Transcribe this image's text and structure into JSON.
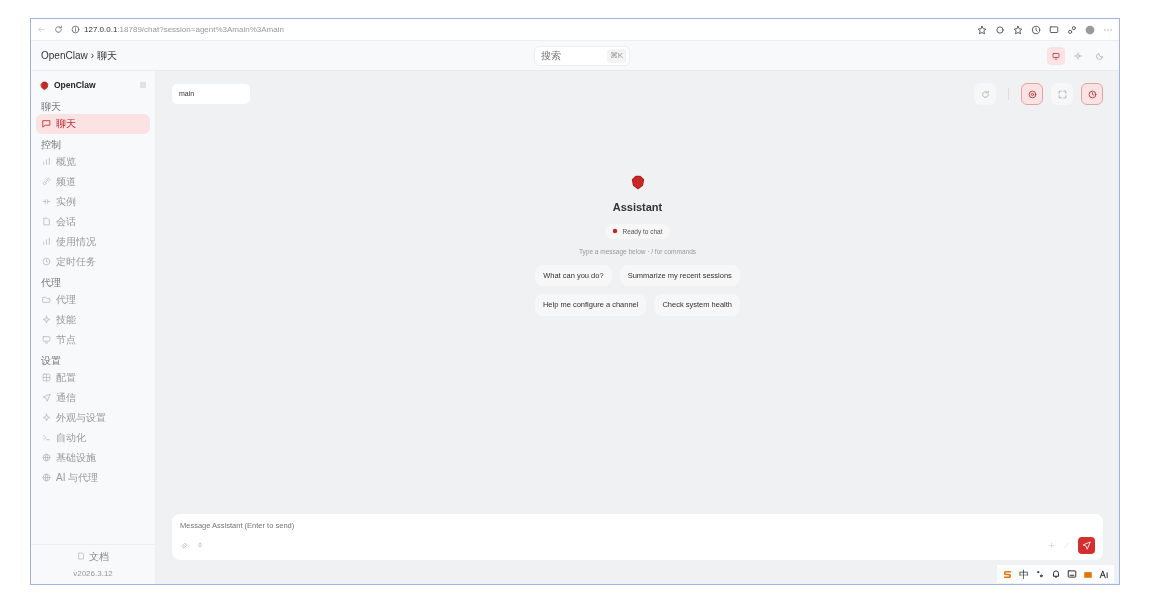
{
  "browser": {
    "url_host": "127.0.0.1",
    "url_rest": ":18789/chat?session=agent%3Amain%3Amain"
  },
  "header": {
    "breadcrumb": [
      "OpenClaw",
      "›",
      "聊天"
    ],
    "search": {
      "placeholder": "搜索",
      "shortcut": "⌘K"
    },
    "theme_options": [
      {
        "selected": true
      },
      {
        "selected": false
      },
      {
        "selected": false
      }
    ]
  },
  "sidebar": {
    "brand": "OpenClaw",
    "groups": [
      {
        "title": "聊天",
        "items": [
          {
            "label": "聊天",
            "selected": true
          }
        ]
      },
      {
        "title": "控制",
        "items": [
          {
            "label": "概览",
            "selected": false
          },
          {
            "label": "频道",
            "selected": false
          },
          {
            "label": "实例",
            "selected": false
          },
          {
            "label": "会话",
            "selected": false
          },
          {
            "label": "使用情况",
            "selected": false
          },
          {
            "label": "定时任务",
            "selected": false
          }
        ]
      },
      {
        "title": "代理",
        "items": [
          {
            "label": "代理",
            "selected": false
          },
          {
            "label": "技能",
            "selected": false
          },
          {
            "label": "节点",
            "selected": false
          }
        ]
      },
      {
        "title": "设置",
        "items": [
          {
            "label": "配置",
            "selected": false
          },
          {
            "label": "通信",
            "selected": false
          },
          {
            "label": "外观与设置",
            "selected": false
          },
          {
            "label": "自动化",
            "selected": false
          },
          {
            "label": "基础设施",
            "selected": false
          },
          {
            "label": "AI 与代理",
            "selected": false
          }
        ]
      }
    ],
    "footer_link": "文档",
    "version": "v2026.3.12"
  },
  "session": {
    "value": "main"
  },
  "toolbar": [
    {
      "on": false
    },
    {
      "on": true
    },
    {
      "on": false
    },
    {
      "on": true
    }
  ],
  "welcome": {
    "title": "Assistant",
    "status": "Ready to chat",
    "hint": "Type a message below · / for commands",
    "suggestions": [
      "What can you do?",
      "Summarize my recent sessions",
      "Help me configure a channel",
      "Check system health"
    ]
  },
  "composer": {
    "placeholder": "Message Assistant (Enter to send)"
  },
  "tray": {
    "ime_label": "中"
  }
}
